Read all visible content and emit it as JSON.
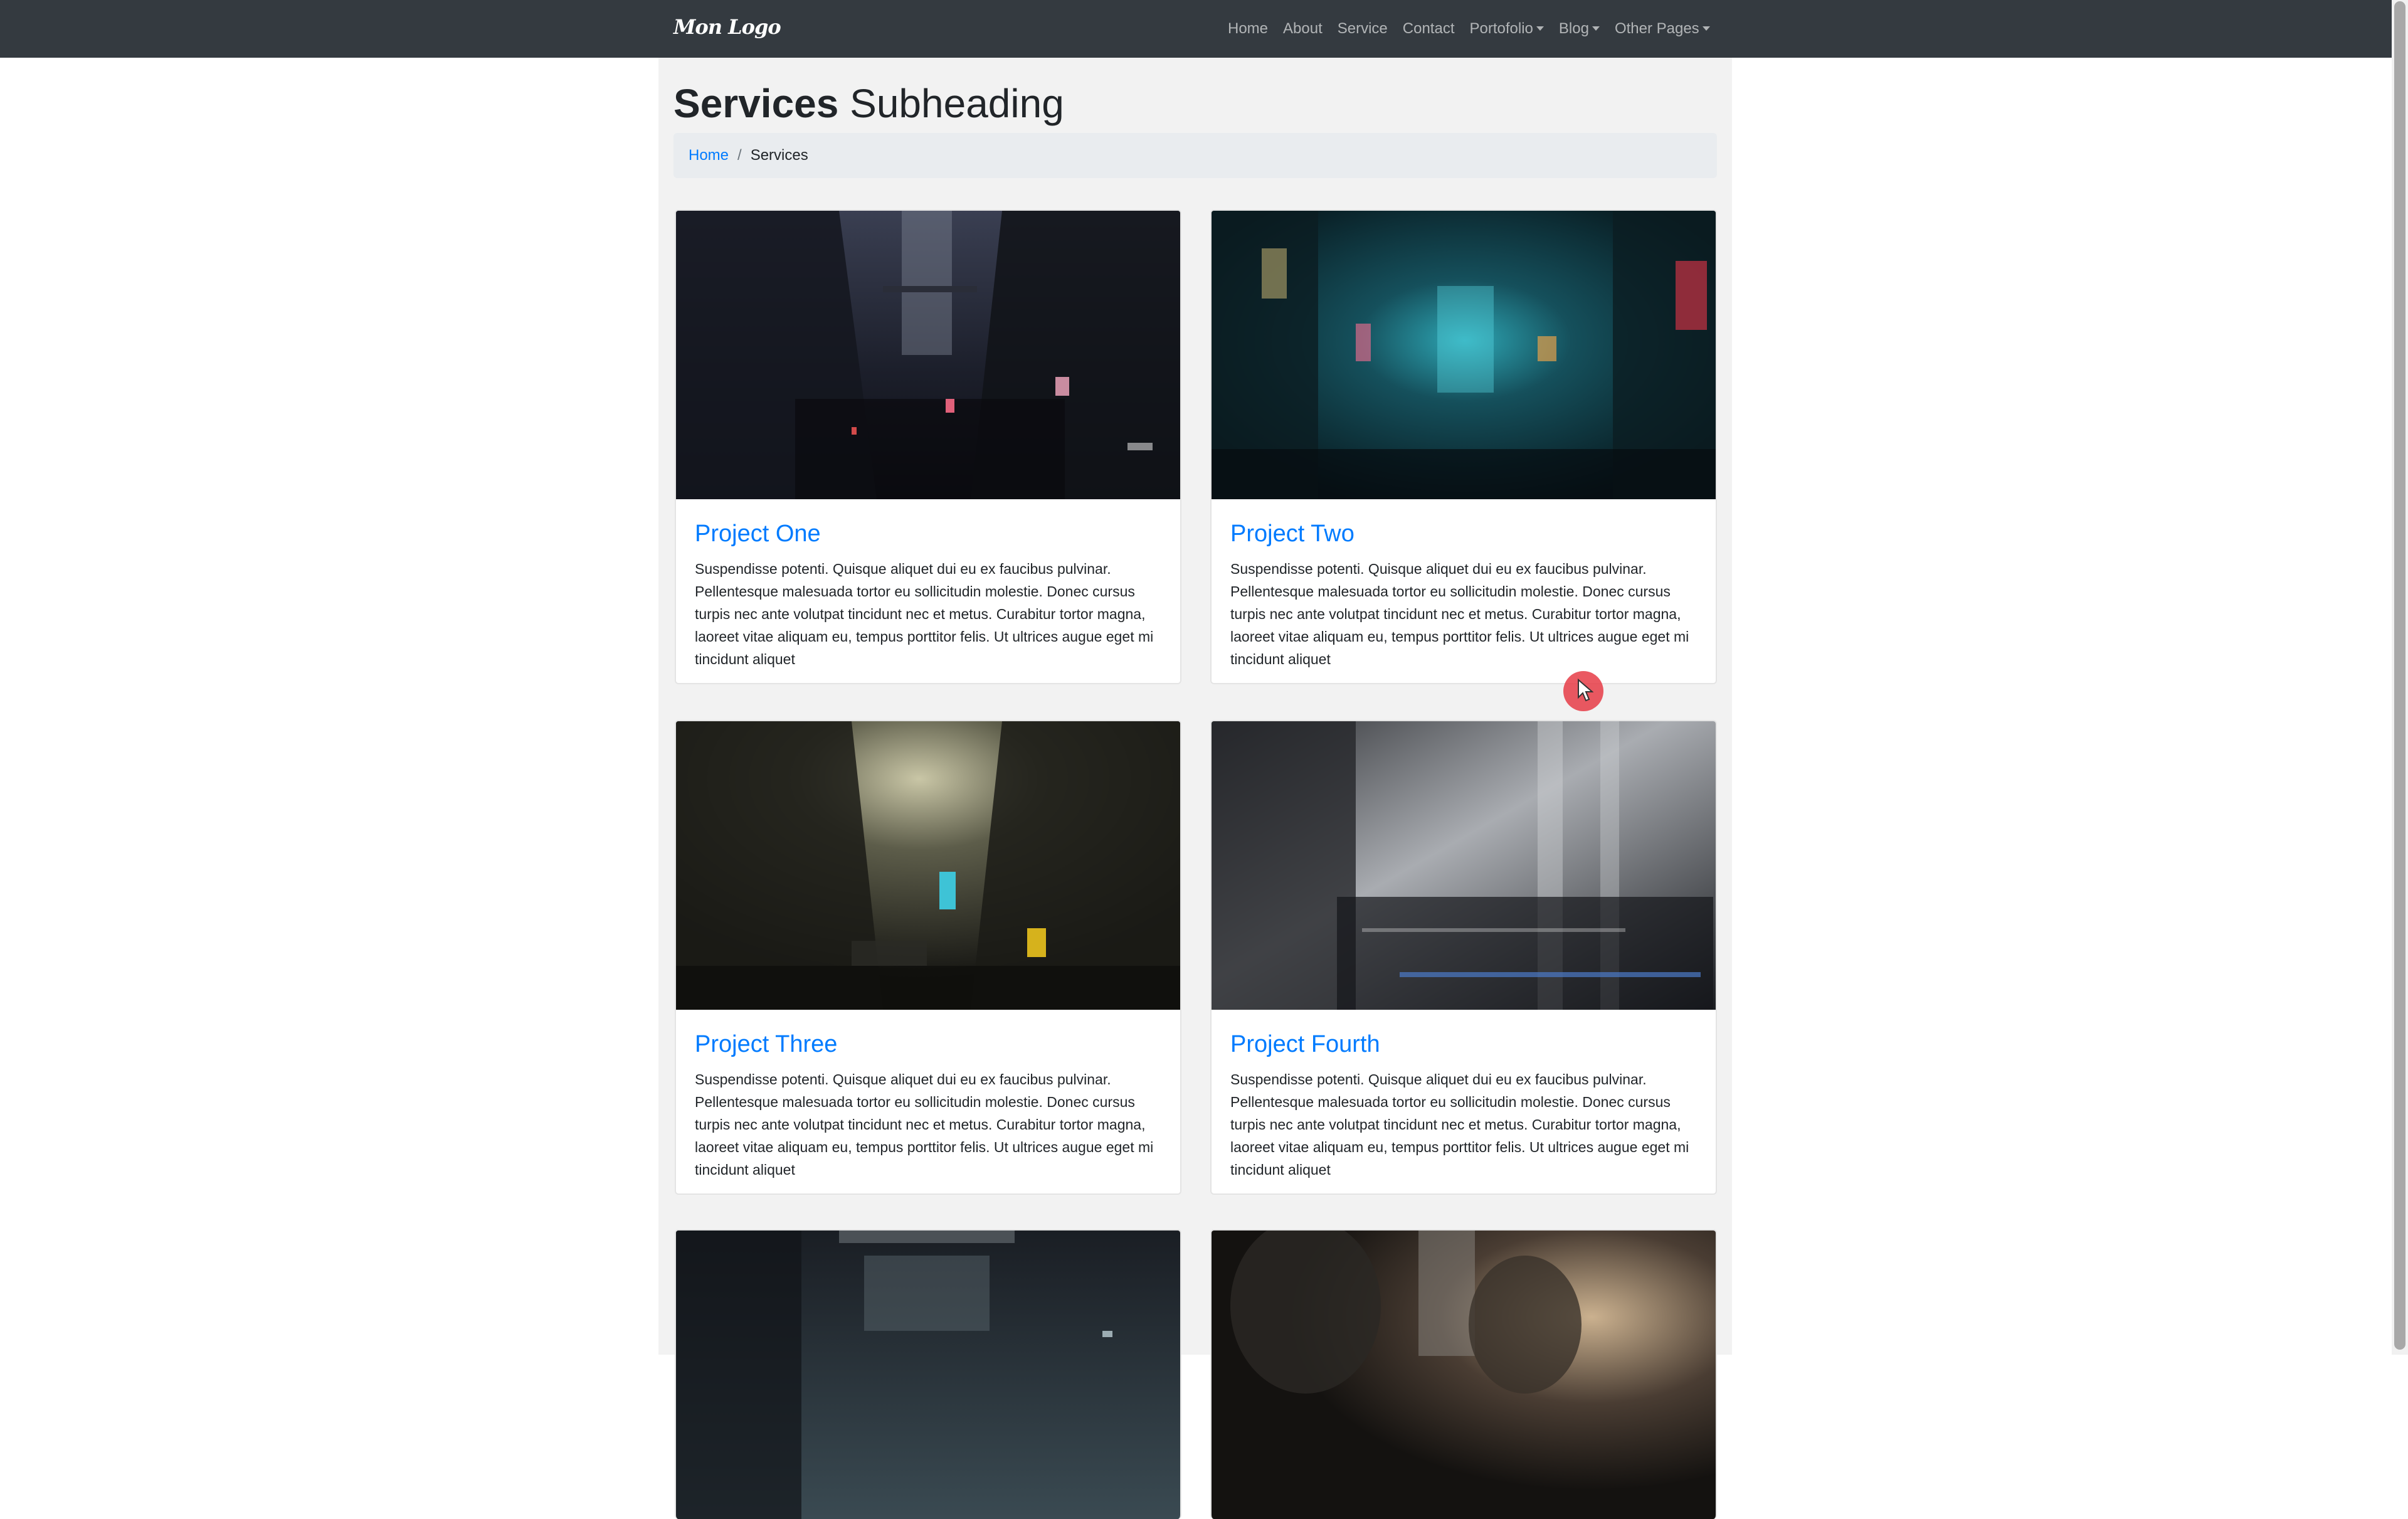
{
  "navbar": {
    "brand": "Mon Logo",
    "links": [
      {
        "label": "Home",
        "dropdown": false
      },
      {
        "label": "About",
        "dropdown": false
      },
      {
        "label": "Service",
        "dropdown": false
      },
      {
        "label": "Contact",
        "dropdown": false
      },
      {
        "label": "Portofolio",
        "dropdown": true
      },
      {
        "label": "Blog",
        "dropdown": true
      },
      {
        "label": "Other Pages",
        "dropdown": true
      }
    ]
  },
  "header": {
    "title_main": "Services",
    "title_sub": "Subheading"
  },
  "breadcrumb": {
    "home": "Home",
    "separator": "/",
    "current": "Services"
  },
  "cards": [
    {
      "title": "Project One",
      "text": "Suspendisse potenti. Quisque aliquet dui eu ex faucibus pulvinar. Pellentesque malesuada tortor eu sollicitudin molestie. Donec cursus turpis nec ante volutpat tincidunt nec et metus. Curabitur tortor magna, laoreet vitae aliquam eu, tempus porttitor felis. Ut ultrices augue eget mi tincidunt aliquet"
    },
    {
      "title": "Project Two",
      "text": "Suspendisse potenti. Quisque aliquet dui eu ex faucibus pulvinar. Pellentesque malesuada tortor eu sollicitudin molestie. Donec cursus turpis nec ante volutpat tincidunt nec et metus. Curabitur tortor magna, laoreet vitae aliquam eu, tempus porttitor felis. Ut ultrices augue eget mi tincidunt aliquet"
    },
    {
      "title": "Project Three",
      "text": "Suspendisse potenti. Quisque aliquet dui eu ex faucibus pulvinar. Pellentesque malesuada tortor eu sollicitudin molestie. Donec cursus turpis nec ante volutpat tincidunt nec et metus. Curabitur tortor magna, laoreet vitae aliquam eu, tempus porttitor felis. Ut ultrices augue eget mi tincidunt aliquet"
    },
    {
      "title": "Project Fourth",
      "text": "Suspendisse potenti. Quisque aliquet dui eu ex faucibus pulvinar. Pellentesque malesuada tortor eu sollicitudin molestie. Donec cursus turpis nec ante volutpat tincidunt nec et metus. Curabitur tortor magna, laoreet vitae aliquam eu, tempus porttitor felis. Ut ultrices augue eget mi tincidunt aliquet"
    }
  ],
  "colors": {
    "navbar_bg": "#343a40",
    "link": "#007bff",
    "page_bg": "#f2f2f2",
    "breadcrumb_bg": "#e9ecef"
  }
}
